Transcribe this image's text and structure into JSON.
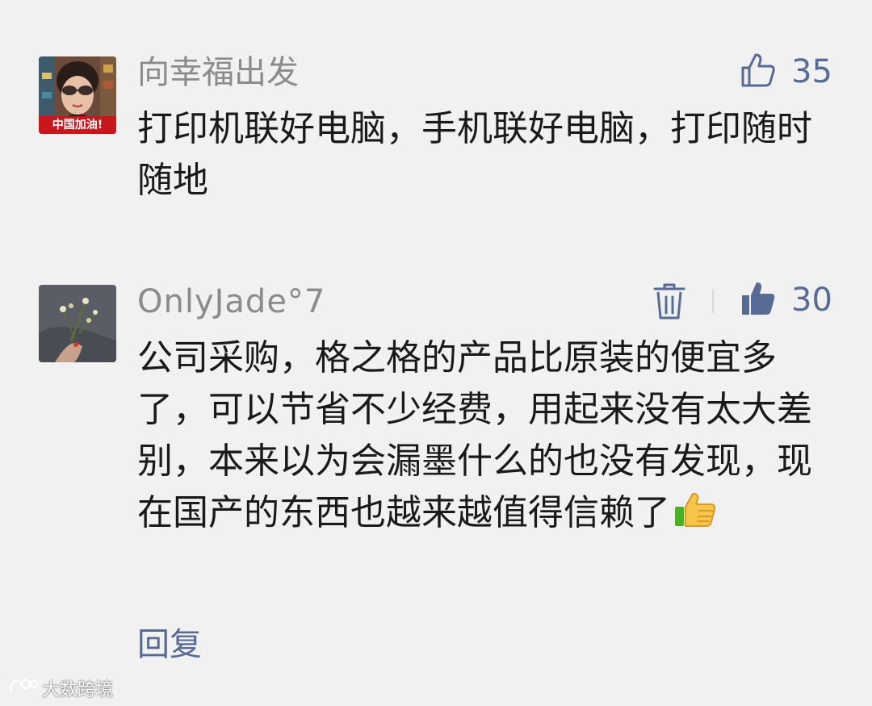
{
  "comments": [
    {
      "username": "向幸福出发",
      "avatar_badge": "中国加油!",
      "text": "打印机联好电脑，手机联好电脑，打印随时随地",
      "like_count": "35",
      "liked": false
    },
    {
      "username": "OnlyJade°7",
      "text": "公司采购，格之格的产品比原装的便宜多了，可以节省不少经费，用起来没有太大差别，本来以为会漏墨什么的也没有发现，现在国产的东西也越来越值得信赖了",
      "like_count": "30",
      "liked": true,
      "has_delete": true
    }
  ],
  "reply_label": "回复",
  "watermark": "大数跨境",
  "colors": {
    "background": "#f1f1f1",
    "link_blue": "#576b95",
    "name_gray": "#8b8b8b",
    "text": "#1a1a1a"
  }
}
